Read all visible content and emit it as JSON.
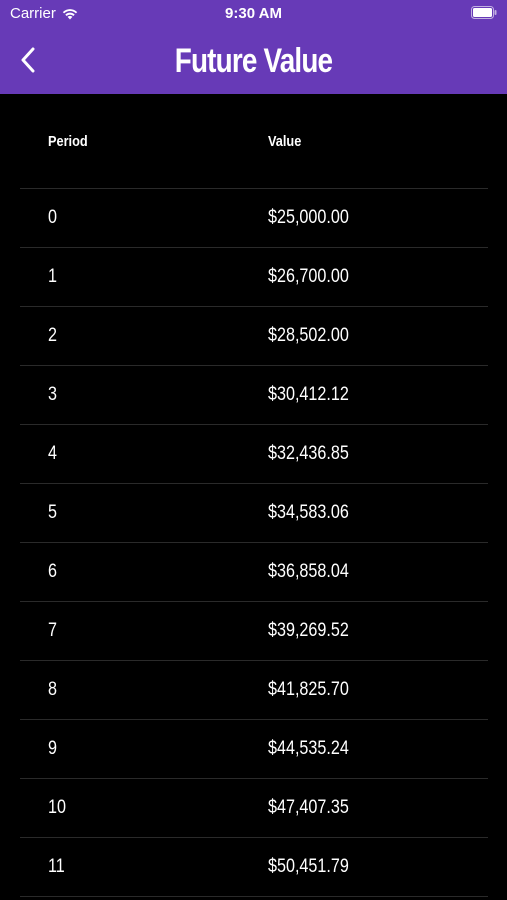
{
  "status_bar": {
    "carrier": "Carrier",
    "time": "9:30 AM"
  },
  "nav": {
    "title": "Future Value",
    "back_icon": "chevron-left-icon"
  },
  "colors": {
    "header_bg": "#673ab7",
    "page_bg": "#000000",
    "text": "#ffffff",
    "divider": "#2a2a2a"
  },
  "table": {
    "headers": {
      "period": "Period",
      "value": "Value"
    },
    "rows": [
      {
        "period": "0",
        "value": "$25,000.00"
      },
      {
        "period": "1",
        "value": "$26,700.00"
      },
      {
        "period": "2",
        "value": "$28,502.00"
      },
      {
        "period": "3",
        "value": "$30,412.12"
      },
      {
        "period": "4",
        "value": "$32,436.85"
      },
      {
        "period": "5",
        "value": "$34,583.06"
      },
      {
        "period": "6",
        "value": "$36,858.04"
      },
      {
        "period": "7",
        "value": "$39,269.52"
      },
      {
        "period": "8",
        "value": "$41,825.70"
      },
      {
        "period": "9",
        "value": "$44,535.24"
      },
      {
        "period": "10",
        "value": "$47,407.35"
      },
      {
        "period": "11",
        "value": "$50,451.79"
      }
    ]
  }
}
